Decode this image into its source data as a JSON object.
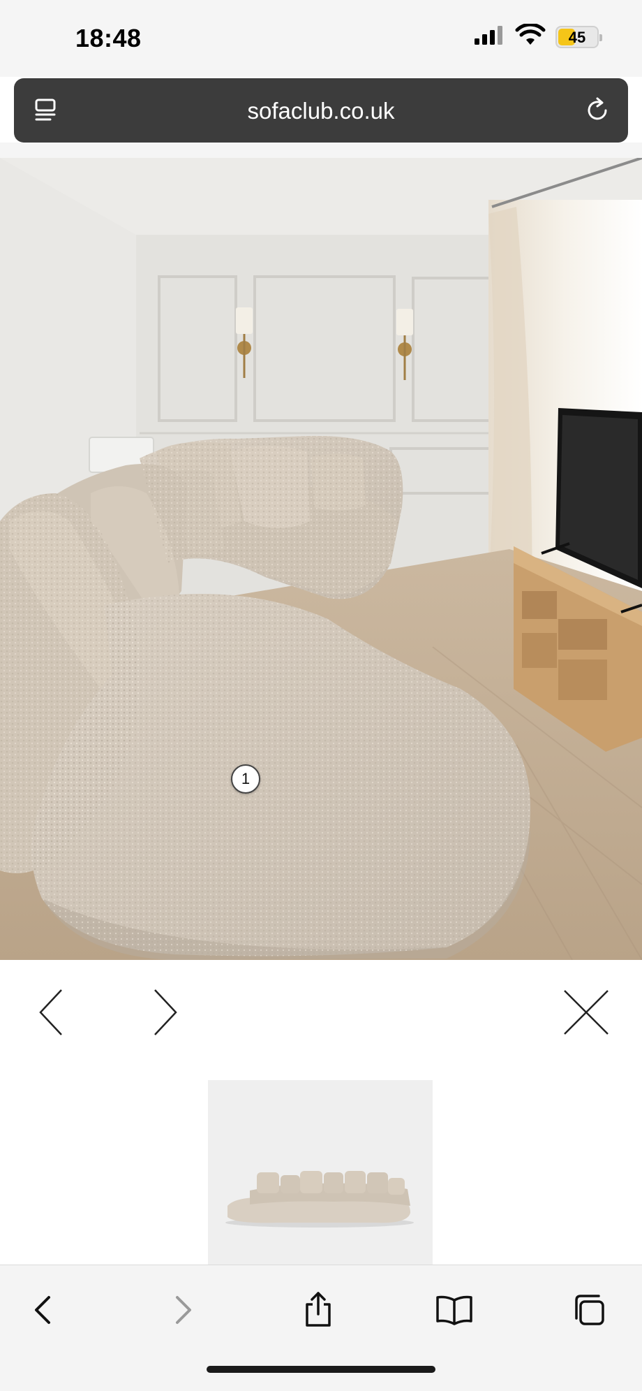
{
  "status_bar": {
    "time": "18:48",
    "battery_level": "45",
    "battery_fraction": 0.45,
    "icons": [
      "signal-icon",
      "wifi-icon",
      "battery-icon"
    ]
  },
  "address_bar": {
    "url": "sofaclub.co.uk",
    "left_icon": "page-menu-icon",
    "right_icon": "reload-icon"
  },
  "gallery": {
    "hotspot_label": "1",
    "prev_icon": "chevron-left-icon",
    "next_icon": "chevron-right-icon",
    "close_icon": "close-icon"
  },
  "toolbar": {
    "icons": [
      "back-icon",
      "forward-icon",
      "share-icon",
      "bookmarks-icon",
      "tabs-icon"
    ]
  },
  "colors": {
    "address_bar_bg": "#3c3c3c",
    "battery_accent": "#f5c518",
    "toolbar_bg": "#f4f4f4"
  }
}
